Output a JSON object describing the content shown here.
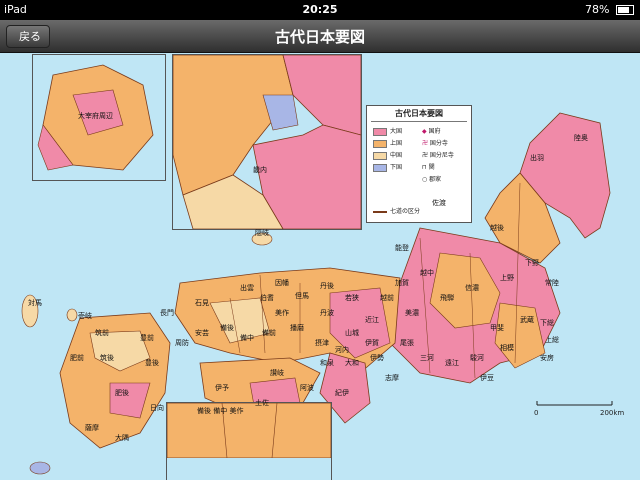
{
  "status": {
    "device": "iPad",
    "time": "20:25",
    "battery": "78%"
  },
  "nav": {
    "back_label": "戻る",
    "title": "古代日本要図"
  },
  "legend": {
    "title": "古代日本要図",
    "items": [
      "大国",
      "上国",
      "中国",
      "下国",
      "国府",
      "国分寺",
      "国分尼寺",
      "関",
      "郡家",
      "七道の区分"
    ]
  },
  "scale": {
    "zero": "0",
    "max": "200km"
  },
  "labels": {
    "mutsu": "陸奥",
    "dewa": "出羽",
    "echigo": "越後",
    "sado": "佐渡",
    "shinano": "信濃",
    "kai": "甲斐",
    "musashi": "武蔵",
    "hitachi": "常陸",
    "shimotsuke": "下野",
    "kozuke": "上野",
    "owari": "尾張",
    "mino": "美濃",
    "omi": "近江",
    "ise": "伊勢",
    "yamato": "大和",
    "kii": "紀伊",
    "harima": "播磨",
    "bizen": "備前",
    "bitchu": "備中",
    "bingo": "備後",
    "aki": "安芸",
    "suo": "周防",
    "nagato": "長門",
    "izumo": "出雲",
    "iwami": "石見",
    "tosa": "土佐",
    "iyo": "伊予",
    "awa": "阿波",
    "sanuki": "讃岐",
    "chikuzen": "筑前",
    "chikugo": "筑後",
    "hizen": "肥前",
    "higo": "肥後",
    "bungo": "豊後",
    "buzen": "豊前",
    "hyuga": "日向",
    "satsuma": "薩摩",
    "osumi": "大隅",
    "tsushima": "対馬",
    "iki": "壱岐",
    "oki": "隠岐",
    "noto": "能登",
    "etchu": "越中",
    "kaga": "加賀",
    "echizen": "越前",
    "wakasa": "若狭",
    "tango": "丹後",
    "tamba": "丹波",
    "tajima": "但馬",
    "inaba": "因幡",
    "hoki": "伯耆",
    "mimasaka": "美作",
    "yamashiro": "山城",
    "settsu": "摂津",
    "kawachi": "河内",
    "izumi": "和泉",
    "iga": "伊賀",
    "shima": "志摩",
    "mikawa": "三河",
    "totomi": "遠江",
    "suruga": "駿河",
    "izu": "伊豆",
    "sagami": "相模",
    "awa2": "安房",
    "kazusa": "上総",
    "shimosa": "下総",
    "hida": "飛騨"
  },
  "insets": {
    "kyushu": "大宰府周辺",
    "kinai": "畿内",
    "kibi": "備後 備中 美作"
  },
  "colors": {
    "sea": "#bfe6f5",
    "great": "#f08aa8",
    "upper": "#f4b36a",
    "middle": "#f6d9a6",
    "lower": "#a8b6e6",
    "border": "#7a3a1a"
  }
}
